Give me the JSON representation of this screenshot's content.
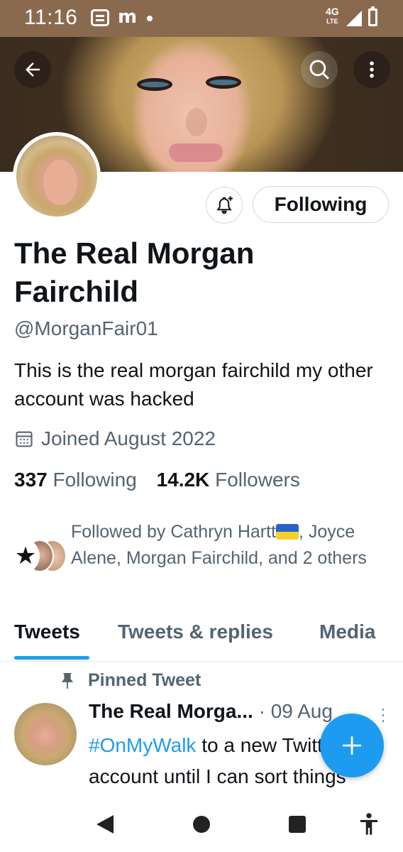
{
  "status_bar": {
    "time": "11:16",
    "network_top": "4G",
    "network_bottom": "LTE"
  },
  "profile": {
    "name": "The Real Morgan Fairchild",
    "handle": "@MorganFair01",
    "bio": "This is the real morgan fairchild my other account was hacked",
    "joined": "Joined August 2022",
    "following_count": "337",
    "following_label": "Following",
    "followers_count": "14.2K",
    "followers_label": "Followers",
    "following_button": "Following",
    "followed_by_prefix": "Followed by Cathryn Hartt",
    "followed_by_suffix": ", Joyce Alene, Morgan Fairchild, and 2 others"
  },
  "tabs": [
    {
      "label": "Tweets",
      "active": true
    },
    {
      "label": "Tweets & replies",
      "active": false
    },
    {
      "label": "Media",
      "active": false
    }
  ],
  "pinned_tweet": {
    "pinned_label": "Pinned Tweet",
    "author": "The Real Morga...",
    "meta": " · 09 Aug",
    "hashtag": "#OnMyWalk",
    "text_rest": " to a new Twitter account until I can sort things"
  },
  "colors": {
    "accent": "#1d9bf0",
    "status_bar": "#8a6a4e",
    "secondary_text": "#536471"
  },
  "icons": [
    "back-arrow-icon",
    "search-icon",
    "more-vertical-icon",
    "bell-plus-icon",
    "calendar-icon",
    "pin-icon",
    "compose-plus-icon",
    "accessibility-icon"
  ]
}
